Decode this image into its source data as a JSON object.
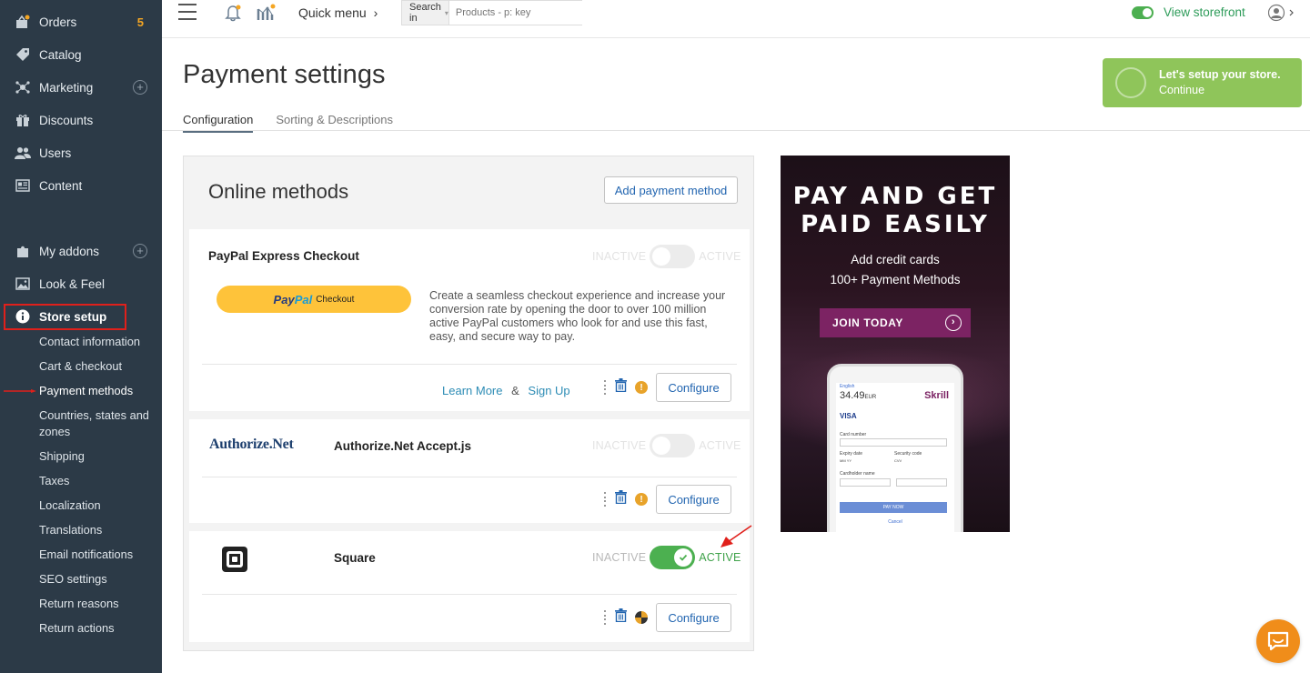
{
  "sidebar": {
    "items": [
      {
        "label": "Orders",
        "icon": "orders-icon",
        "badge": "5"
      },
      {
        "label": "Catalog",
        "icon": "tag-icon"
      },
      {
        "label": "Marketing",
        "icon": "marketing-icon"
      },
      {
        "label": "Discounts",
        "icon": "gift-icon"
      },
      {
        "label": "Users",
        "icon": "users-icon"
      },
      {
        "label": "Content",
        "icon": "content-icon"
      },
      {
        "label": "My addons",
        "icon": "puzzle-icon"
      },
      {
        "label": "Look & Feel",
        "icon": "image-icon"
      },
      {
        "label": "Store setup",
        "icon": "info-icon"
      }
    ],
    "store_setup_sub": [
      "Contact information",
      "Cart & checkout",
      "Payment methods",
      "Countries, states and zones",
      "Shipping",
      "Taxes",
      "Localization",
      "Translations",
      "Email notifications",
      "SEO settings",
      "Return reasons",
      "Return actions"
    ]
  },
  "topbar": {
    "quick_menu": "Quick menu",
    "search_in": "Search in",
    "search_placeholder": "Products - p: key",
    "view_storefront": "View storefront"
  },
  "page": {
    "title": "Payment settings",
    "tabs": [
      "Configuration",
      "Sorting & Descriptions"
    ]
  },
  "setup_banner": {
    "line1": "Let's setup your store.",
    "line2": "Continue"
  },
  "online_methods": {
    "title": "Online methods",
    "add_button": "Add payment method",
    "inactive_label": "INACTIVE",
    "active_label": "ACTIVE",
    "configure_label": "Configure",
    "methods": [
      {
        "name": "PayPal Express Checkout",
        "active": false,
        "paypal_button": {
          "pay": "Pay",
          "pal": "Pal",
          "checkout": "Checkout"
        },
        "description": "Create a seamless checkout experience and increase your conversion rate by opening the door to over 100 million active PayPal customers who look for and use this fast, easy, and secure way to pay.",
        "learn_more": "Learn More",
        "amp": "&",
        "sign_up": "Sign Up"
      },
      {
        "name": "Authorize.Net Accept.js",
        "logo_text": "Authorize.Net",
        "active": false
      },
      {
        "name": "Square",
        "active": true
      }
    ]
  },
  "ad": {
    "headline_line1": "PAY AND GET",
    "headline_line2": "PAID EASILY",
    "sub_line1": "Add credit cards",
    "sub_line2": "100+ Payment Methods",
    "button": "JOIN TODAY",
    "phone": {
      "lang": "English",
      "amount": "34.49",
      "currency": "EUR",
      "brand": "Skrill",
      "cards": "VISA",
      "card_number": "Card number",
      "expiry": "Expiry date",
      "security": "Security code",
      "mm": "MM",
      "yy": "YY",
      "cvv": "CVV",
      "holder": "Cardholder name",
      "pay_now": "PAY NOW",
      "cancel": "Cancel"
    }
  },
  "colors": {
    "sidebar_bg": "#2c3a47",
    "accent_green": "#4cb050",
    "link_blue": "#2265b0",
    "badge_orange": "#f5a623",
    "highlight_red": "#e0201b"
  }
}
